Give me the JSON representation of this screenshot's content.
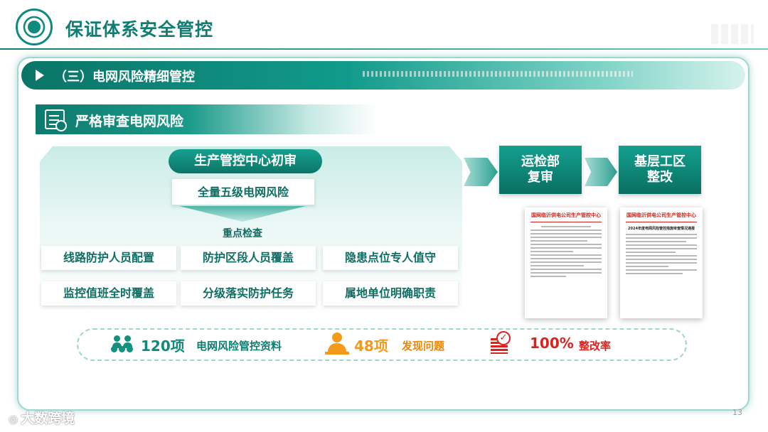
{
  "header": {
    "title": "保证体系安全管控"
  },
  "section": {
    "label": "（三）电网风险精细管控"
  },
  "subsection": {
    "title": "严格审查电网风险"
  },
  "flow": {
    "center_title": "生产管控中心初审",
    "all_risk_label": "全量五级电网风险",
    "focus_label": "重点检查",
    "items": [
      "线路防护人员配置",
      "防护区段人员覆盖",
      "隐患点位专人值守",
      "监控值班全时覆盖",
      "分级落实防护任务",
      "属地单位明确职责"
    ],
    "stage2_line1": "运检部",
    "stage2_line2": "复审",
    "stage3_line1": "基层工区",
    "stage3_line2": "整改"
  },
  "documents": [
    {
      "header": "国网临沂供电公司生产管控中心"
    },
    {
      "header": "国网临沂供电公司生产管控中心",
      "title": "2024年度电网风险管控措施审查情况通报"
    }
  ],
  "stats": [
    {
      "number": "120项",
      "label": "电网风险管控资料",
      "color": "#0f8a7e",
      "icon": "people-group-icon"
    },
    {
      "number": "48项",
      "label": "发现问题",
      "color": "#f39a1a",
      "icon": "user-desk-icon"
    },
    {
      "number": "100%",
      "label": "整改率",
      "color": "#d9241e",
      "icon": "checklist-icon"
    }
  ],
  "footer": {
    "brand": "大数跨境",
    "page_number": "13"
  },
  "colors": {
    "primary": "#0f7d72",
    "accent_orange": "#f39a1a",
    "accent_red": "#d9241e"
  }
}
